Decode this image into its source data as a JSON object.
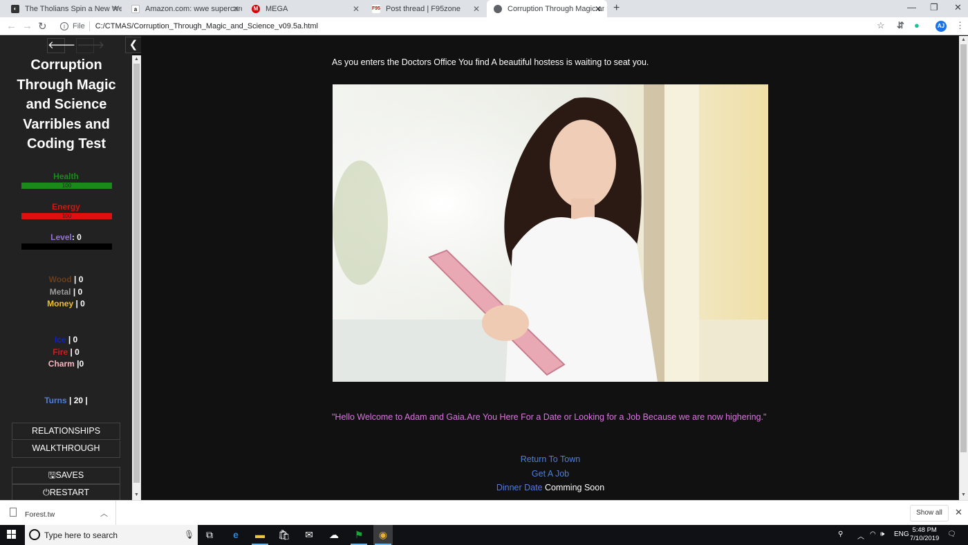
{
  "browser": {
    "tabs": [
      {
        "title": "The Tholians Spin a New Web | S",
        "icon": "tholians-favicon",
        "active": false
      },
      {
        "title": "Amazon.com: wwe supercard",
        "icon": "amazon-favicon",
        "active": false
      },
      {
        "title": "MEGA",
        "icon": "mega-favicon",
        "active": false
      },
      {
        "title": "Post thread | F95zone",
        "icon": "f95zone-favicon",
        "active": false
      },
      {
        "title": "Corruption Through Magic and S",
        "icon": "globe-favicon",
        "active": true
      }
    ],
    "address": {
      "scheme_label": "File",
      "url": "C:/CTMAS/Corruption_Through_Magic_and_Science_v09.5a.html"
    },
    "profile_initials": "AJ"
  },
  "sidebar": {
    "title": "Corruption Through Magic and Science Varribles and Coding Test",
    "stats": {
      "health": {
        "label": "Health",
        "value": "100",
        "fraction": 1.0,
        "color": "#1a8a1a"
      },
      "energy": {
        "label": "Energy",
        "value": "100",
        "fraction": 1.0,
        "color": "#e01010"
      },
      "level": {
        "label": "Level",
        "sep": ": ",
        "value": "0",
        "fraction": 0.0,
        "color": "#9370db"
      }
    },
    "resources": [
      {
        "name": "Wood",
        "value": " | 0",
        "color": "#6b3e1a"
      },
      {
        "name": "Metal",
        "value": " | 0",
        "color": "#9a9a9a"
      },
      {
        "name": "Money",
        "value": " | 0",
        "color": "#f0c020"
      }
    ],
    "elements": [
      {
        "name": "Ice",
        "value": " | 0",
        "color": "#1020d0"
      },
      {
        "name": "Fire",
        "value": " | 0",
        "color": "#ee1010"
      },
      {
        "name": "Charm",
        "value": " |0",
        "color": "#f4b8c0"
      }
    ],
    "turns": {
      "name": "Turns",
      "value": " | 20 |",
      "color": "#4f7fde"
    },
    "menu": {
      "relationships": "RELATIONSHIPS",
      "walkthrough": "WALKTHROUGH",
      "saves": "SAVES",
      "restart": "RESTART"
    }
  },
  "passage": {
    "intro": "As you enters the Doctors Office You find A beautiful hostess is waiting to seat you.",
    "image_alt": "hostess holding a pink clipboard",
    "quote": "\"Hello Welcome to Adam and Gaia.Are You Here For a Date or Looking for a Job Because we are now highering.\"",
    "links": {
      "return_town": "Return To Town",
      "get_job": "Get A Job",
      "dinner_date": "Dinner Date",
      "dinner_note": " Comming Soon"
    }
  },
  "downloads": {
    "file": "Forest.tw",
    "show_all": "Show all"
  },
  "taskbar": {
    "search_placeholder": "Type here to search",
    "language": "ENG",
    "time": "5:48 PM",
    "date": "7/10/2019"
  }
}
